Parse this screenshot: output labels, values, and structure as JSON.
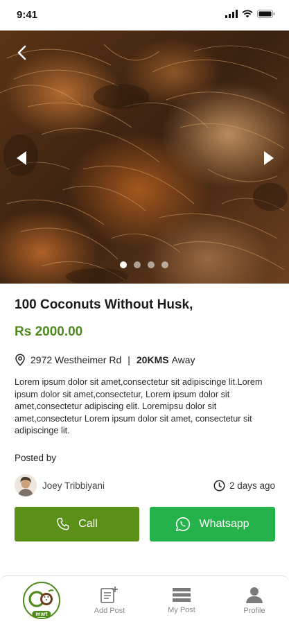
{
  "status_bar": {
    "time": "9:41"
  },
  "gallery": {
    "total_images": 4,
    "active_index": 0
  },
  "product": {
    "title": "100 Coconuts Without Husk,",
    "price": "Rs 2000.00",
    "address": "2972 Westheimer Rd",
    "separator": "|",
    "distance": "20KMS",
    "distance_suffix": "Away",
    "description": "Lorem ipsum dolor sit amet,consectetur sit adipiscinge lit.Lorem ipsum dolor sit amet,consectetur, Lorem ipsum dolor sit amet,consectetur adipiscing elit. Loremipsu dolor sit amet,consectetur Lorem ipsum dolor sit amet, consectetur sit adipiscinge lit."
  },
  "poster": {
    "heading": "Posted by",
    "name": "Joey Tribbiyani",
    "time_ago": "2 days ago"
  },
  "actions": {
    "call_label": "Call",
    "whatsapp_label": "Whatsapp"
  },
  "bottom_nav": {
    "logo_text": "mart",
    "add_post_label": "Add Post",
    "my_post_label": "My Post",
    "profile_label": "Profile"
  },
  "colors": {
    "price_green": "#4f8a1e",
    "call_button": "#5a8f18",
    "whatsapp_button": "#25b24a"
  }
}
